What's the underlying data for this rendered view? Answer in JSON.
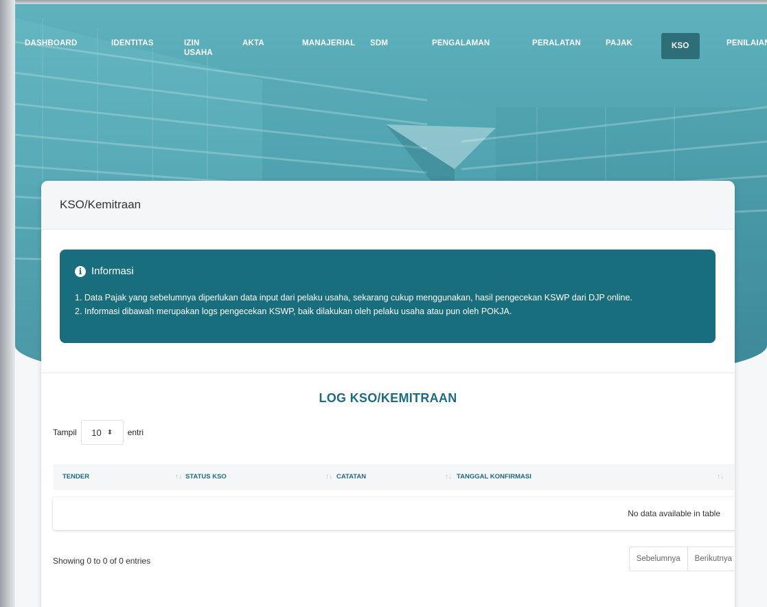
{
  "nav": [
    {
      "label": "DASHBOARD",
      "active": false
    },
    {
      "label": "IDENTITAS",
      "active": false
    },
    {
      "label": "IZIN\nUSAHA",
      "active": false
    },
    {
      "label": "AKTA",
      "active": false
    },
    {
      "label": "MANAJERIAL",
      "active": false
    },
    {
      "label": "SDM",
      "active": false
    },
    {
      "label": "PENGALAMAN",
      "active": false
    },
    {
      "label": "PERALATAN",
      "active": false
    },
    {
      "label": "PAJAK",
      "active": false
    },
    {
      "label": "KSO",
      "active": true
    },
    {
      "label": "PENILAIAN",
      "active": false
    }
  ],
  "card": {
    "title": "KSO/Kemitraan"
  },
  "info": {
    "title": "Informasi",
    "line1": "1. Data Pajak yang sebelumnya diperlukan data input dari pelaku usaha, sekarang cukup menggunakan, hasil pengecekan KSWP dari DJP online.",
    "line2": "2. Informasi dibawah merupakan logs pengecekan KSWP, baik dilakukan oleh pelaku usaha atau pun oleh POKJA."
  },
  "log": {
    "title": "LOG KSO/KEMITRAAN",
    "length_prefix": "Tampil",
    "length_value": "10",
    "length_suffix": "entri",
    "columns": [
      "TENDER",
      "STATUS KSO",
      "CATATAN",
      "TANGGAL KONFIRMASI"
    ],
    "empty_text": "No data available in table",
    "info_text": "Showing 0 to 0 of 0 entries",
    "prev_label": "Sebelumnya",
    "next_label": "Berikutnya"
  },
  "colors": {
    "accent": "#196e7d",
    "heading": "#1b6c80",
    "nav_active": "#2d6e78"
  }
}
